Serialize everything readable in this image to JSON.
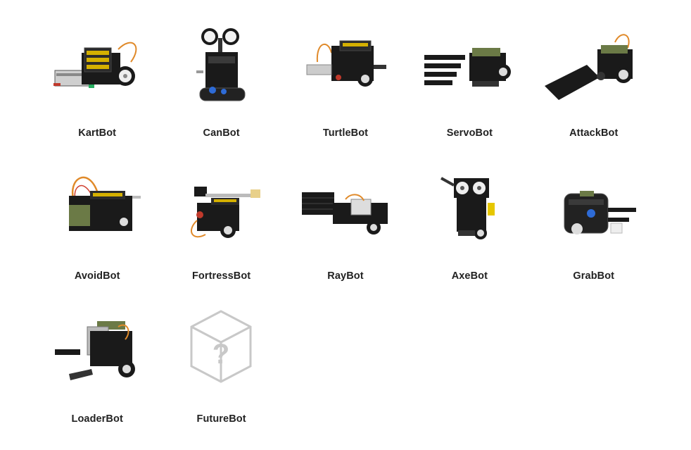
{
  "robots": [
    {
      "name": "KartBot",
      "icon": "kartbot-image"
    },
    {
      "name": "CanBot",
      "icon": "canbot-image"
    },
    {
      "name": "TurtleBot",
      "icon": "turtlebot-image"
    },
    {
      "name": "ServoBot",
      "icon": "servobot-image"
    },
    {
      "name": "AttackBot",
      "icon": "attackbot-image"
    },
    {
      "name": "AvoidBot",
      "icon": "avoidbot-image"
    },
    {
      "name": "FortressBot",
      "icon": "fortressbot-image"
    },
    {
      "name": "RayBot",
      "icon": "raybot-image"
    },
    {
      "name": "AxeBot",
      "icon": "axebot-image"
    },
    {
      "name": "GrabBot",
      "icon": "grabbot-image"
    },
    {
      "name": "LoaderBot",
      "icon": "loaderbot-image"
    },
    {
      "name": "FutureBot",
      "icon": "question-cube-icon"
    }
  ],
  "colors": {
    "label": "#222222",
    "chassis": "#1a1a1a",
    "wire_orange": "#e08a2a",
    "placeholder": "#c8c8c8"
  }
}
